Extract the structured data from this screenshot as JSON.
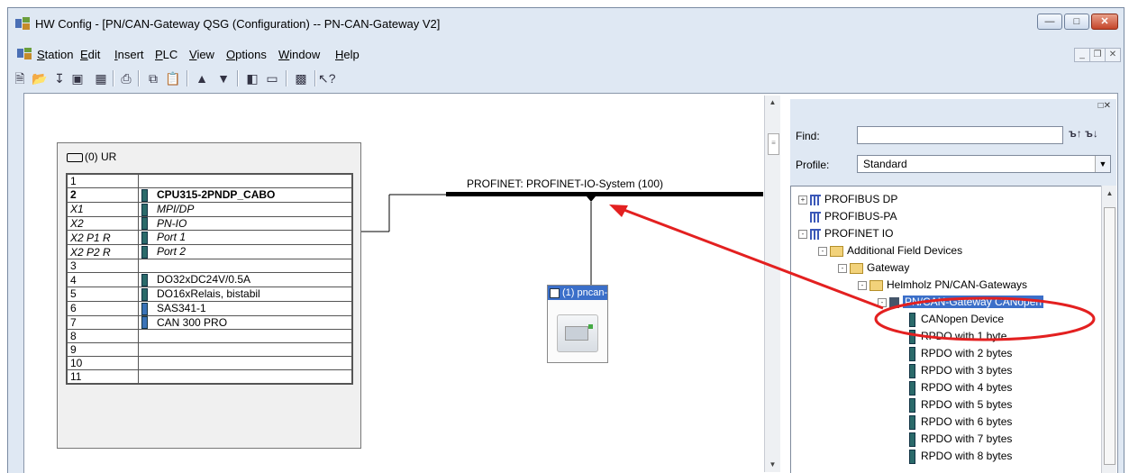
{
  "window": {
    "title": "HW Config - [PN/CAN-Gateway QSG (Configuration) -- PN-CAN-Gateway V2]"
  },
  "menu": {
    "items": [
      {
        "label": "Station",
        "u": "S"
      },
      {
        "label": "Edit",
        "u": "E"
      },
      {
        "label": "Insert",
        "u": "I"
      },
      {
        "label": "PLC",
        "u": "P"
      },
      {
        "label": "View",
        "u": "V"
      },
      {
        "label": "Options",
        "u": "O"
      },
      {
        "label": "Window",
        "u": "W"
      },
      {
        "label": "Help",
        "u": "H"
      }
    ]
  },
  "toolbar": {
    "icons": [
      "new-icon",
      "open-icon",
      "download-icon",
      "save-icon",
      "compile-icon",
      "print-icon",
      "copy-icon",
      "paste-icon",
      "load-plc-icon",
      "upload-plc-icon",
      "catalog-icon",
      "network-view-icon",
      "properties-icon",
      "help-icon"
    ]
  },
  "rack": {
    "title": "(0) UR",
    "rows": [
      {
        "slot": "1",
        "module": "",
        "bold": false,
        "italic": false,
        "icon": "none"
      },
      {
        "slot": "2",
        "module": "CPU315-2PNDP_CABO",
        "bold": true,
        "italic": false,
        "icon": "module"
      },
      {
        "slot": "X1",
        "module": "MPI/DP",
        "bold": false,
        "italic": true,
        "icon": "module"
      },
      {
        "slot": "X2",
        "module": "PN-IO",
        "bold": false,
        "italic": true,
        "icon": "module"
      },
      {
        "slot": "X2 P1 R",
        "module": "Port 1",
        "bold": false,
        "italic": true,
        "icon": "module"
      },
      {
        "slot": "X2 P2 R",
        "module": "Port 2",
        "bold": false,
        "italic": true,
        "icon": "module"
      },
      {
        "slot": "3",
        "module": "",
        "bold": false,
        "italic": false,
        "icon": "none"
      },
      {
        "slot": "4",
        "module": "DO32xDC24V/0.5A",
        "bold": false,
        "italic": false,
        "icon": "module"
      },
      {
        "slot": "5",
        "module": "DO16xRelais, bistabil",
        "bold": false,
        "italic": false,
        "icon": "module"
      },
      {
        "slot": "6",
        "module": "SAS341-1",
        "bold": false,
        "italic": false,
        "icon": "cp"
      },
      {
        "slot": "7",
        "module": "CAN 300 PRO",
        "bold": false,
        "italic": false,
        "icon": "cp"
      },
      {
        "slot": "8",
        "module": "",
        "bold": false,
        "italic": false,
        "icon": "none"
      },
      {
        "slot": "9",
        "module": "",
        "bold": false,
        "italic": false,
        "icon": "none"
      },
      {
        "slot": "10",
        "module": "",
        "bold": false,
        "italic": false,
        "icon": "none"
      },
      {
        "slot": "11",
        "module": "",
        "bold": false,
        "italic": false,
        "icon": "none"
      }
    ]
  },
  "network": {
    "label": "PROFINET: PROFINET-IO-System (100)",
    "device_label": "(1) pncan-te"
  },
  "catalog": {
    "find_label": "Find:",
    "find_value": "",
    "profile_label": "Profile:",
    "profile_value": "Standard",
    "tree": [
      {
        "label": "PROFIBUS DP",
        "level": 0,
        "icon": "net",
        "expander": "+",
        "selected": false
      },
      {
        "label": "PROFIBUS-PA",
        "level": 0,
        "icon": "net",
        "expander": "",
        "selected": false
      },
      {
        "label": "PROFINET IO",
        "level": 0,
        "icon": "net",
        "expander": "-",
        "selected": false
      },
      {
        "label": "Additional Field Devices",
        "level": 1,
        "icon": "folder",
        "expander": "-",
        "selected": false
      },
      {
        "label": "Gateway",
        "level": 2,
        "icon": "folder",
        "expander": "-",
        "selected": false
      },
      {
        "label": "Helmholz PN/CAN-Gateways",
        "level": 3,
        "icon": "folder",
        "expander": "-",
        "selected": false
      },
      {
        "label": "PN/CAN-Gateway CANopen",
        "level": 4,
        "icon": "gateway",
        "expander": "-",
        "selected": true
      },
      {
        "label": "CANopen Device",
        "level": 5,
        "icon": "module",
        "expander": "",
        "selected": false
      },
      {
        "label": "RPDO with 1 byte",
        "level": 5,
        "icon": "module",
        "expander": "",
        "selected": false
      },
      {
        "label": "RPDO with 2 bytes",
        "level": 5,
        "icon": "module",
        "expander": "",
        "selected": false
      },
      {
        "label": "RPDO with 3 bytes",
        "level": 5,
        "icon": "module",
        "expander": "",
        "selected": false
      },
      {
        "label": "RPDO with 4 bytes",
        "level": 5,
        "icon": "module",
        "expander": "",
        "selected": false
      },
      {
        "label": "RPDO with 5 bytes",
        "level": 5,
        "icon": "module",
        "expander": "",
        "selected": false
      },
      {
        "label": "RPDO with 6 bytes",
        "level": 5,
        "icon": "module",
        "expander": "",
        "selected": false
      },
      {
        "label": "RPDO with 7 bytes",
        "level": 5,
        "icon": "module",
        "expander": "",
        "selected": false
      },
      {
        "label": "RPDO with 8 bytes",
        "level": 5,
        "icon": "module",
        "expander": "",
        "selected": false
      }
    ]
  },
  "annotation": {
    "color": "#e32020"
  }
}
